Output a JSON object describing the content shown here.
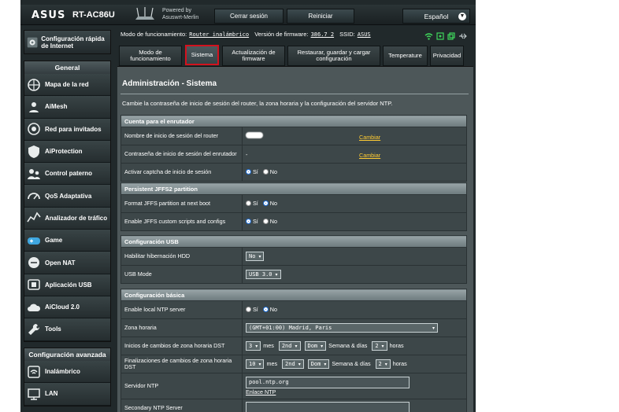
{
  "header": {
    "logo": "ASUS",
    "model": "RT-AC86U",
    "powered_by": "Powered by",
    "firmware_brand": "Asuswrt-Merlin",
    "logout": "Cerrar sesión",
    "reboot": "Reiniciar",
    "language": "Español"
  },
  "sidebar": {
    "quick_setup": "Configuración rápida de Internet",
    "general_title": "General",
    "general_items": [
      {
        "label": "Mapa de la red",
        "icon": "network-map-icon"
      },
      {
        "label": "AiMesh",
        "icon": "aimesh-icon"
      },
      {
        "label": "Red para invitados",
        "icon": "guest-network-icon"
      },
      {
        "label": "AiProtection",
        "icon": "shield-icon"
      },
      {
        "label": "Control paterno",
        "icon": "parental-control-icon"
      },
      {
        "label": "QoS Adaptativa",
        "icon": "speedometer-icon"
      },
      {
        "label": "Analizador de tráfico",
        "icon": "traffic-analyzer-icon"
      },
      {
        "label": "Game",
        "icon": "gamepad-icon"
      },
      {
        "label": "Open NAT",
        "icon": "open-nat-icon"
      },
      {
        "label": "Aplicación USB",
        "icon": "usb-icon"
      },
      {
        "label": "AiCloud 2.0",
        "icon": "cloud-icon"
      },
      {
        "label": "Tools",
        "icon": "wrench-icon"
      }
    ],
    "advanced_title": "Configuración avanzada",
    "advanced_items": [
      {
        "label": "Inalámbrico",
        "icon": "wifi-icon"
      },
      {
        "label": "LAN",
        "icon": "lan-icon"
      }
    ]
  },
  "infobar": {
    "mode_label": "Modo de funcionamiento:",
    "mode_value": "Router inalámbrico",
    "fw_label": "Versión de firmware:",
    "fw_value": "386.7_2",
    "ssid_label": "SSID:",
    "ssid_value": "ASUS"
  },
  "tabs": [
    "Modo de funcionamiento",
    "Sistema",
    "Actualización de firmware",
    "Restaurar, guardar y cargar configuración",
    "Temperature",
    "Privacidad"
  ],
  "page": {
    "title": "Administración - Sistema",
    "description": "Cambie la contraseña de inicio de sesión del router, la zona horaria y la configuración del servidor NTP."
  },
  "groups": {
    "account": {
      "title": "Cuenta para el enrutador",
      "rows": [
        {
          "label": "Nombre de inicio de sesión del router",
          "value": "",
          "link": "Cambiar"
        },
        {
          "label": "Contraseña de inicio de sesión del enrutador",
          "value": "-",
          "link": "Cambiar"
        },
        {
          "label": "Activar captcha de inicio de sesión",
          "yes": "Sí",
          "no": "No"
        }
      ]
    },
    "jffs": {
      "title": "Persistent JFFS2 partition",
      "rows": [
        {
          "label": "Format JFFS partition at next boot",
          "yes": "Sí",
          "no": "No"
        },
        {
          "label": "Enable JFFS custom scripts and configs",
          "yes": "Sí",
          "no": "No"
        }
      ]
    },
    "usb": {
      "title": "Configuración USB",
      "rows": [
        {
          "label": "Habilitar hibernación HDD",
          "value": "No"
        },
        {
          "label": "USB Mode",
          "value": "USB 3.0"
        }
      ]
    },
    "basic": {
      "title": "Configuración básica",
      "rows": [
        {
          "label": "Enable local NTP server",
          "yes": "Sí",
          "no": "No"
        },
        {
          "label": "Zona horaria",
          "value": "(GMT+01:00) Madrid, Paris"
        },
        {
          "label": "Inicios de cambios de zona horaria DST",
          "month": "3",
          "month_lbl": "mes",
          "week": "2nd",
          "day": "Dom",
          "week_day_lbl": "Semana & días",
          "hour": "2",
          "hour_lbl": "horas"
        },
        {
          "label": "Finalizaciones de cambios de zona horaria DST",
          "month": "10",
          "month_lbl": "mes",
          "week": "2nd",
          "day": "Dom",
          "week_day_lbl": "Semana & días",
          "hour": "2",
          "hour_lbl": "horas"
        },
        {
          "label": "Servidor NTP",
          "value": "pool.ntp.org",
          "link": "Enlace NTP"
        },
        {
          "label": "Secondary NTP Server",
          "value": ""
        }
      ]
    }
  }
}
